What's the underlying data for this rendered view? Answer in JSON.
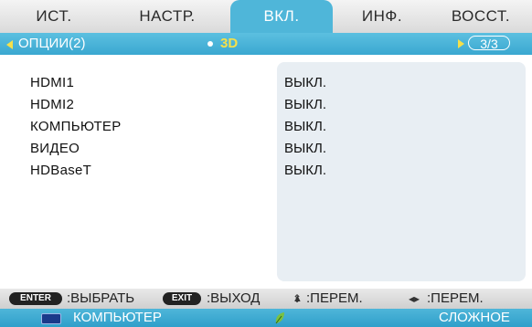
{
  "tabs": [
    "ИСТ.",
    "НАСТР.",
    "ВКЛ.",
    "ИНФ.",
    "ВОССТ."
  ],
  "subbar": {
    "left_label": "ОПЦИИ(2)",
    "active_label": "3D",
    "page": "3/3"
  },
  "rows": [
    {
      "label": "HDMI1",
      "value": "ВЫКЛ."
    },
    {
      "label": "HDMI2",
      "value": "ВЫКЛ."
    },
    {
      "label": "КОМПЬЮТЕР",
      "value": "ВЫКЛ."
    },
    {
      "label": "ВИДЕО",
      "value": "ВЫКЛ."
    },
    {
      "label": "HDBaseT",
      "value": "ВЫКЛ."
    }
  ],
  "guide": {
    "enter_key": "ENTER",
    "enter_text": ":ВЫБРАТЬ",
    "exit_key": "EXIT",
    "exit_text": ":ВЫХОД",
    "updown_text": ":ПЕРЕМ.",
    "leftright_text": ":ПЕРЕМ."
  },
  "status": {
    "source": "КОМПЬЮТЕР",
    "mode": "СЛОЖНОЕ"
  },
  "colors": {
    "accent": "#4fb6d9",
    "arrow": "#f5e04a",
    "highlight": "#f5e04a",
    "eco": "#7ac142"
  },
  "icons": [
    "monitor-icon",
    "eco-leaf-icon",
    "arrow-left-icon",
    "arrow-right-icon",
    "updown-arrow-icon",
    "leftright-arrow-icon"
  ]
}
